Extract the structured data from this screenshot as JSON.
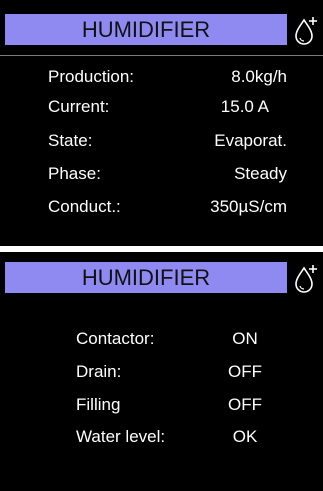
{
  "colors": {
    "title_bar_bg": "#8f8af2",
    "screen_bg": "#000000",
    "text": "#ffffff"
  },
  "screens": [
    {
      "title": "HUMIDIFIER",
      "icon": "water-drop-plus-icon",
      "rows": [
        {
          "label": "Production:",
          "value": "8.0kg/h"
        },
        {
          "label": "Current:",
          "value": "15.0 A"
        },
        {
          "label": "State:",
          "value": "Evaporat."
        },
        {
          "label": "Phase:",
          "value": "Steady"
        },
        {
          "label": "Conduct.:",
          "value": "350µS/cm"
        }
      ]
    },
    {
      "title": "HUMIDIFIER",
      "icon": "water-drop-plus-icon",
      "rows": [
        {
          "label": "Contactor:",
          "value": "ON"
        },
        {
          "label": "Drain:",
          "value": "OFF"
        },
        {
          "label": "Filling",
          "value": "OFF"
        },
        {
          "label": "Water level:",
          "value": "OK"
        }
      ]
    }
  ]
}
